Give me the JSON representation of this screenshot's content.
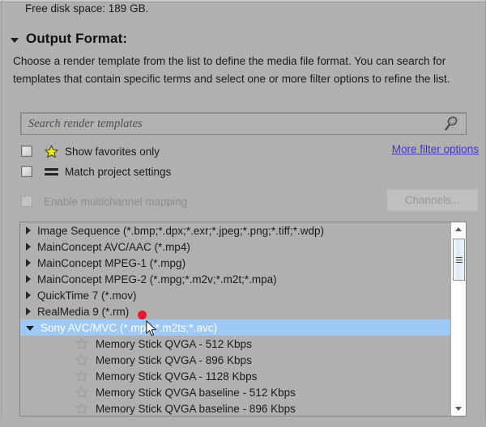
{
  "status_bar": {
    "free_disk_space": "Free disk space: 189 GB."
  },
  "section": {
    "toggle_icon": "triangle-down-icon",
    "title": "Output Format:",
    "description": "Choose a render template from the list to define the media file format. You can search for templates that contain specific terms and select one or more filter options to refine the list."
  },
  "search": {
    "placeholder": "Search render templates",
    "value": "",
    "icon": "search-magnifier-icon"
  },
  "filters": {
    "items": [
      {
        "label": "Show favorites only",
        "icon": "star-icon",
        "checked": false
      },
      {
        "label": "Match project settings",
        "icon": "equals-icon",
        "checked": false
      }
    ],
    "more_filter_options": "More filter options"
  },
  "multichannel": {
    "label": "Enable multichannel mapping",
    "checked": false,
    "enabled": false,
    "channels_button": "Channels..."
  },
  "template_tree": {
    "rows": [
      {
        "label": "Image Sequence (*.bmp;*.dpx;*.exr;*.jpeg;*.png;*.tiff;*.wdp)",
        "level": 0,
        "expanded": false,
        "selected": false
      },
      {
        "label": "MainConcept AVC/AAC (*.mp4)",
        "level": 0,
        "expanded": false,
        "selected": false
      },
      {
        "label": "MainConcept MPEG-1 (*.mpg)",
        "level": 0,
        "expanded": false,
        "selected": false
      },
      {
        "label": "MainConcept MPEG-2 (*.mpg;*.m2v;*.m2t;*.mpa)",
        "level": 0,
        "expanded": false,
        "selected": false
      },
      {
        "label": "QuickTime 7 (*.mov)",
        "level": 0,
        "expanded": false,
        "selected": false
      },
      {
        "label": "RealMedia 9 (*.rm)",
        "level": 0,
        "expanded": false,
        "selected": false
      },
      {
        "label": "Sony AVC/MVC (*.mp4;*.m2ts;*.avc)",
        "level": 0,
        "expanded": true,
        "selected": true
      },
      {
        "label": "Memory Stick QVGA - 512 Kbps",
        "level": 1,
        "expanded": false,
        "selected": false
      },
      {
        "label": "Memory Stick QVGA - 896 Kbps",
        "level": 1,
        "expanded": false,
        "selected": false
      },
      {
        "label": "Memory Stick QVGA - 1128 Kbps",
        "level": 1,
        "expanded": false,
        "selected": false
      },
      {
        "label": "Memory Stick QVGA baseline - 512 Kbps",
        "level": 1,
        "expanded": false,
        "selected": false
      },
      {
        "label": "Memory Stick QVGA baseline - 896 Kbps",
        "level": 1,
        "expanded": false,
        "selected": false
      }
    ],
    "scrollbar": {
      "up_arrow": "scroll-up-icon",
      "down_arrow": "scroll-down-icon",
      "thumb_position_pct": 8
    }
  },
  "colors": {
    "window_background": "#b0b0b0",
    "selection_blue": "#9cc9f5",
    "link_violet": "#3f35cf",
    "star_yellow": "#f2e515",
    "disabled_gray": "#8e8e8e",
    "marker_red": "#e8172a",
    "list_background": "#b0b0b0"
  },
  "pointer": {
    "cursor_icon": "arrow-cursor",
    "marker_icon": "red-dot-marker"
  }
}
